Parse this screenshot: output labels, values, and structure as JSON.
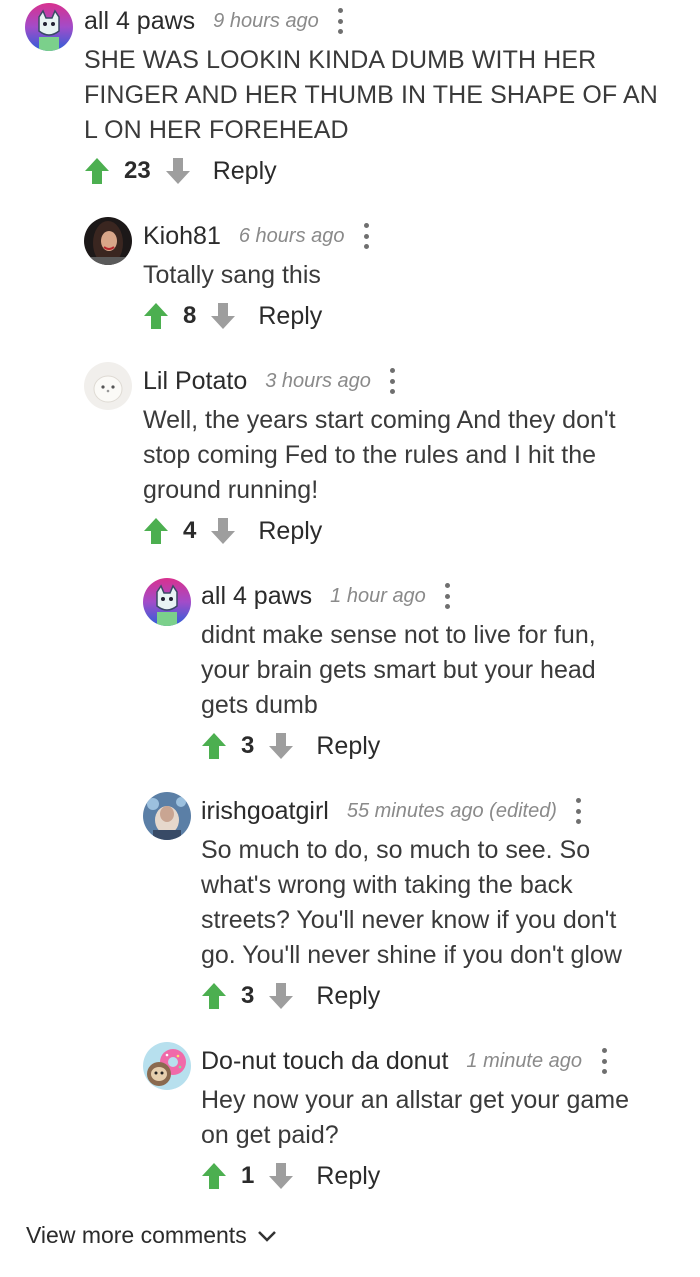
{
  "comments": [
    {
      "username": "all 4 paws",
      "timestamp": "9 hours ago",
      "text": "SHE WAS LOOKIN KINDA DUMB WITH HER\nFINGER AND HER THUMB IN THE SHAPE OF AN\nL ON HER FOREHEAD",
      "votes": "23",
      "reply_label": "Reply",
      "avatar_icon": "cat-avatar-icon"
    },
    {
      "username": "Kioh81",
      "timestamp": "6 hours ago",
      "text": "Totally sang this",
      "votes": "8",
      "reply_label": "Reply",
      "avatar_icon": "user-photo-avatar-icon"
    },
    {
      "username": "Lil Potato",
      "timestamp": "3 hours ago",
      "text": "Well, the years start coming And they don't\nstop coming Fed to the rules and I hit the\nground running!",
      "votes": "4",
      "reply_label": "Reply",
      "avatar_icon": "potato-avatar-icon"
    },
    {
      "username": "all 4 paws",
      "timestamp": "1 hour ago",
      "text": "didnt make sense not to live for fun,\nyour brain gets smart but your head\ngets dumb",
      "votes": "3",
      "reply_label": "Reply",
      "avatar_icon": "cat-avatar-icon"
    },
    {
      "username": "irishgoatgirl",
      "timestamp": "55 minutes ago (edited)",
      "text": "So much to do, so much to see. So\nwhat's wrong with taking the back\nstreets? You'll never know if you don't\ngo. You'll never shine if you don't glow",
      "votes": "3",
      "reply_label": "Reply",
      "avatar_icon": "goat-avatar-icon"
    },
    {
      "username": "Do-nut touch da donut",
      "timestamp": "1 minute ago",
      "text": "Hey now your an allstar get your game\non get paid?",
      "votes": "1",
      "reply_label": "Reply",
      "avatar_icon": "sloth-donut-avatar-icon"
    }
  ],
  "view_more_label": "View more comments",
  "colors": {
    "upvote": "#4caf50",
    "downvote": "#9e9e9e",
    "text": "#333333",
    "timestamp": "#8a8a8a"
  }
}
